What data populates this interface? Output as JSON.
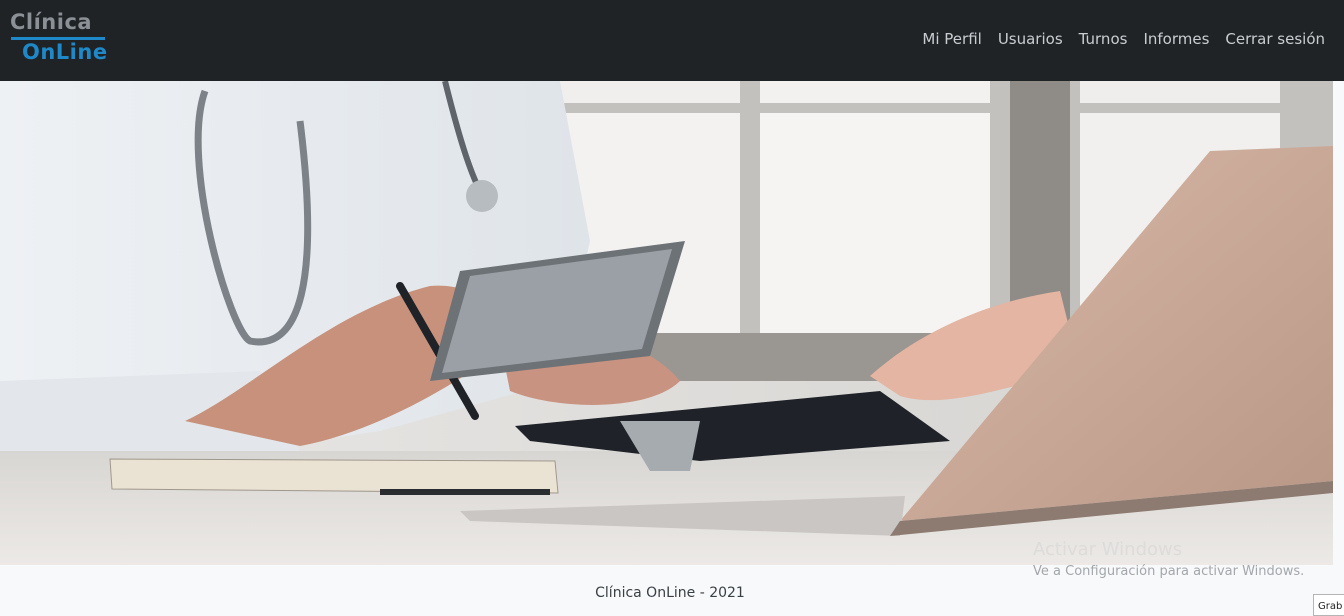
{
  "brand": {
    "line1": "Clínica",
    "line2": "OnLine"
  },
  "nav": {
    "items": [
      {
        "label": "Mi Perfil"
      },
      {
        "label": "Usuarios"
      },
      {
        "label": "Turnos"
      },
      {
        "label": "Informes"
      },
      {
        "label": "Cerrar sesión"
      }
    ]
  },
  "footer": {
    "text": "Clínica OnLine - 2021"
  },
  "windows_watermark": {
    "line1": "Activar Windows",
    "line2": "Ve a Configuración para activar Windows."
  },
  "grab_button": {
    "label": "Grab"
  },
  "colors": {
    "navbar_bg": "#1f2326",
    "brand_accent": "#1e88c8",
    "nav_text": "#c9cdd1",
    "footer_bg": "#f8f9fa"
  }
}
